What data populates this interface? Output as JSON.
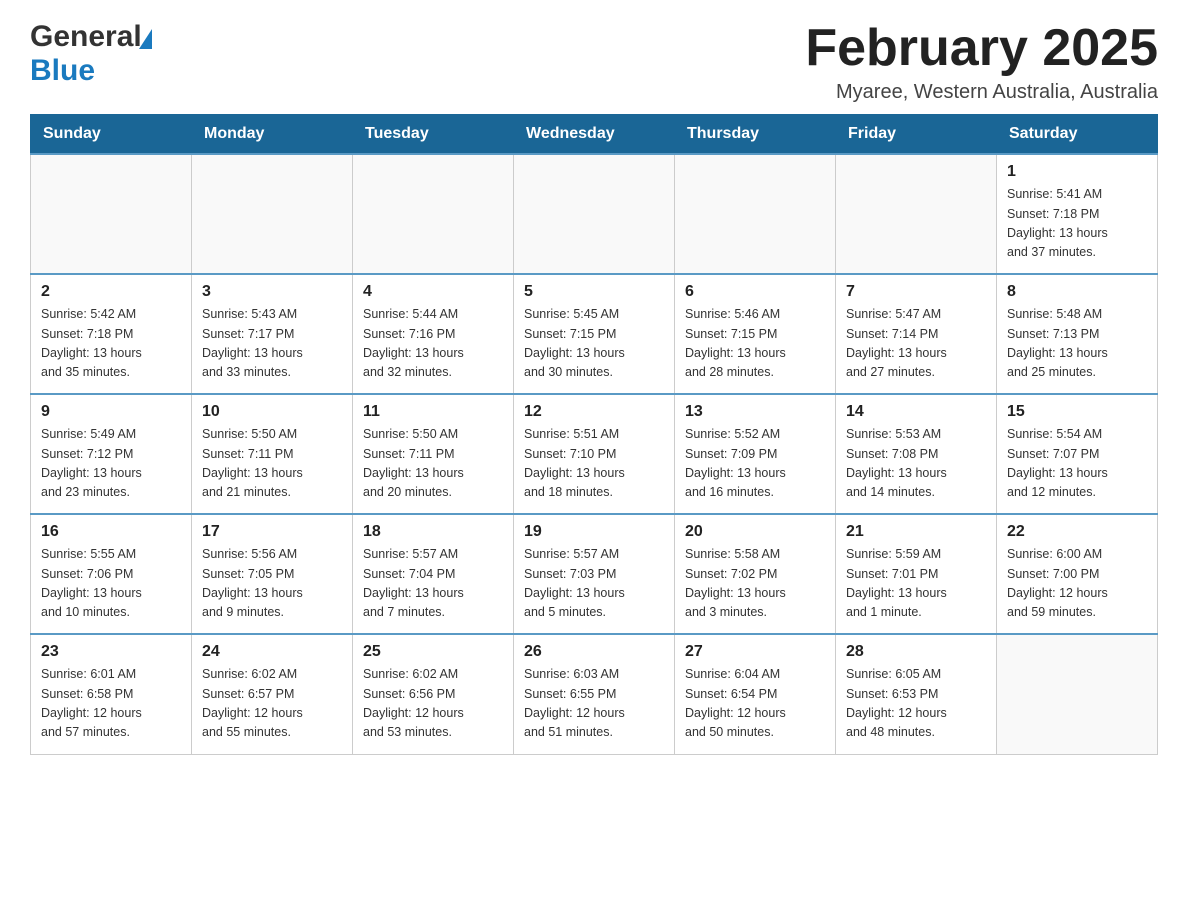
{
  "header": {
    "logo_general": "General",
    "logo_blue": "Blue",
    "month_title": "February 2025",
    "location": "Myaree, Western Australia, Australia"
  },
  "days_of_week": [
    "Sunday",
    "Monday",
    "Tuesday",
    "Wednesday",
    "Thursday",
    "Friday",
    "Saturday"
  ],
  "weeks": [
    {
      "days": [
        {
          "num": "",
          "info": ""
        },
        {
          "num": "",
          "info": ""
        },
        {
          "num": "",
          "info": ""
        },
        {
          "num": "",
          "info": ""
        },
        {
          "num": "",
          "info": ""
        },
        {
          "num": "",
          "info": ""
        },
        {
          "num": "1",
          "info": "Sunrise: 5:41 AM\nSunset: 7:18 PM\nDaylight: 13 hours\nand 37 minutes."
        }
      ]
    },
    {
      "days": [
        {
          "num": "2",
          "info": "Sunrise: 5:42 AM\nSunset: 7:18 PM\nDaylight: 13 hours\nand 35 minutes."
        },
        {
          "num": "3",
          "info": "Sunrise: 5:43 AM\nSunset: 7:17 PM\nDaylight: 13 hours\nand 33 minutes."
        },
        {
          "num": "4",
          "info": "Sunrise: 5:44 AM\nSunset: 7:16 PM\nDaylight: 13 hours\nand 32 minutes."
        },
        {
          "num": "5",
          "info": "Sunrise: 5:45 AM\nSunset: 7:15 PM\nDaylight: 13 hours\nand 30 minutes."
        },
        {
          "num": "6",
          "info": "Sunrise: 5:46 AM\nSunset: 7:15 PM\nDaylight: 13 hours\nand 28 minutes."
        },
        {
          "num": "7",
          "info": "Sunrise: 5:47 AM\nSunset: 7:14 PM\nDaylight: 13 hours\nand 27 minutes."
        },
        {
          "num": "8",
          "info": "Sunrise: 5:48 AM\nSunset: 7:13 PM\nDaylight: 13 hours\nand 25 minutes."
        }
      ]
    },
    {
      "days": [
        {
          "num": "9",
          "info": "Sunrise: 5:49 AM\nSunset: 7:12 PM\nDaylight: 13 hours\nand 23 minutes."
        },
        {
          "num": "10",
          "info": "Sunrise: 5:50 AM\nSunset: 7:11 PM\nDaylight: 13 hours\nand 21 minutes."
        },
        {
          "num": "11",
          "info": "Sunrise: 5:50 AM\nSunset: 7:11 PM\nDaylight: 13 hours\nand 20 minutes."
        },
        {
          "num": "12",
          "info": "Sunrise: 5:51 AM\nSunset: 7:10 PM\nDaylight: 13 hours\nand 18 minutes."
        },
        {
          "num": "13",
          "info": "Sunrise: 5:52 AM\nSunset: 7:09 PM\nDaylight: 13 hours\nand 16 minutes."
        },
        {
          "num": "14",
          "info": "Sunrise: 5:53 AM\nSunset: 7:08 PM\nDaylight: 13 hours\nand 14 minutes."
        },
        {
          "num": "15",
          "info": "Sunrise: 5:54 AM\nSunset: 7:07 PM\nDaylight: 13 hours\nand 12 minutes."
        }
      ]
    },
    {
      "days": [
        {
          "num": "16",
          "info": "Sunrise: 5:55 AM\nSunset: 7:06 PM\nDaylight: 13 hours\nand 10 minutes."
        },
        {
          "num": "17",
          "info": "Sunrise: 5:56 AM\nSunset: 7:05 PM\nDaylight: 13 hours\nand 9 minutes."
        },
        {
          "num": "18",
          "info": "Sunrise: 5:57 AM\nSunset: 7:04 PM\nDaylight: 13 hours\nand 7 minutes."
        },
        {
          "num": "19",
          "info": "Sunrise: 5:57 AM\nSunset: 7:03 PM\nDaylight: 13 hours\nand 5 minutes."
        },
        {
          "num": "20",
          "info": "Sunrise: 5:58 AM\nSunset: 7:02 PM\nDaylight: 13 hours\nand 3 minutes."
        },
        {
          "num": "21",
          "info": "Sunrise: 5:59 AM\nSunset: 7:01 PM\nDaylight: 13 hours\nand 1 minute."
        },
        {
          "num": "22",
          "info": "Sunrise: 6:00 AM\nSunset: 7:00 PM\nDaylight: 12 hours\nand 59 minutes."
        }
      ]
    },
    {
      "days": [
        {
          "num": "23",
          "info": "Sunrise: 6:01 AM\nSunset: 6:58 PM\nDaylight: 12 hours\nand 57 minutes."
        },
        {
          "num": "24",
          "info": "Sunrise: 6:02 AM\nSunset: 6:57 PM\nDaylight: 12 hours\nand 55 minutes."
        },
        {
          "num": "25",
          "info": "Sunrise: 6:02 AM\nSunset: 6:56 PM\nDaylight: 12 hours\nand 53 minutes."
        },
        {
          "num": "26",
          "info": "Sunrise: 6:03 AM\nSunset: 6:55 PM\nDaylight: 12 hours\nand 51 minutes."
        },
        {
          "num": "27",
          "info": "Sunrise: 6:04 AM\nSunset: 6:54 PM\nDaylight: 12 hours\nand 50 minutes."
        },
        {
          "num": "28",
          "info": "Sunrise: 6:05 AM\nSunset: 6:53 PM\nDaylight: 12 hours\nand 48 minutes."
        },
        {
          "num": "",
          "info": ""
        }
      ]
    }
  ]
}
